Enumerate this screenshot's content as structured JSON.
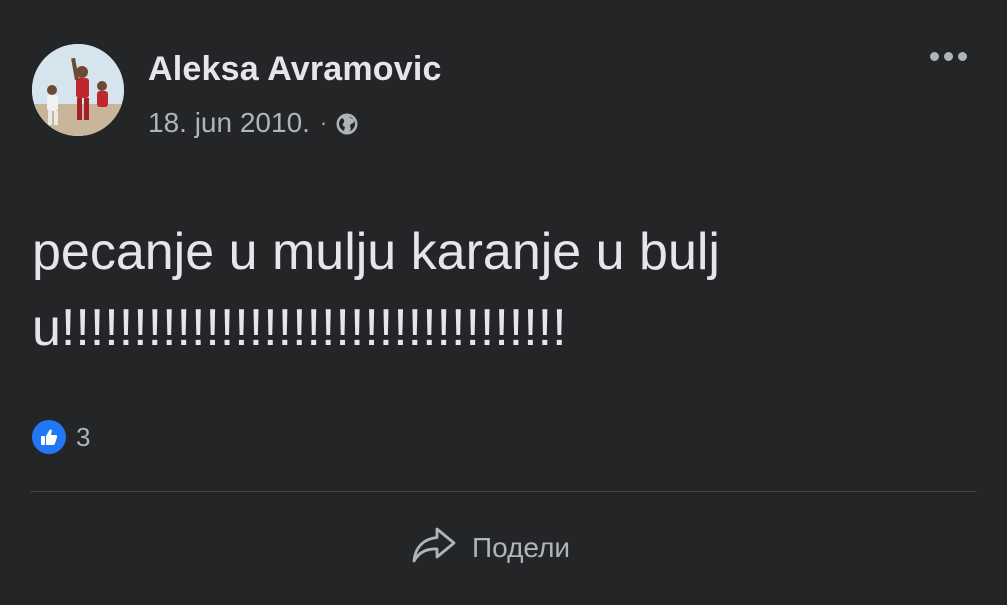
{
  "post": {
    "author": "Aleksa Avramovic",
    "date": "18. jun 2010.",
    "separator": "·",
    "privacy_icon": "globe-icon",
    "text": "pecanje u mulju karanje u bulju!!!!!!!!!!!!!!!!!!!!!!!!!!!!!!!!!!!",
    "reactions": {
      "icon": "like-icon",
      "count": "3"
    },
    "actions": {
      "share_label": "Подели",
      "share_icon": "share-arrow-icon"
    },
    "more_icon": "more-options-icon"
  },
  "colors": {
    "background": "#242527",
    "primary_text": "#e4e6eb",
    "secondary_text": "#b0b3b8",
    "like_blue": "#2078f4",
    "divider": "#3e4042"
  }
}
